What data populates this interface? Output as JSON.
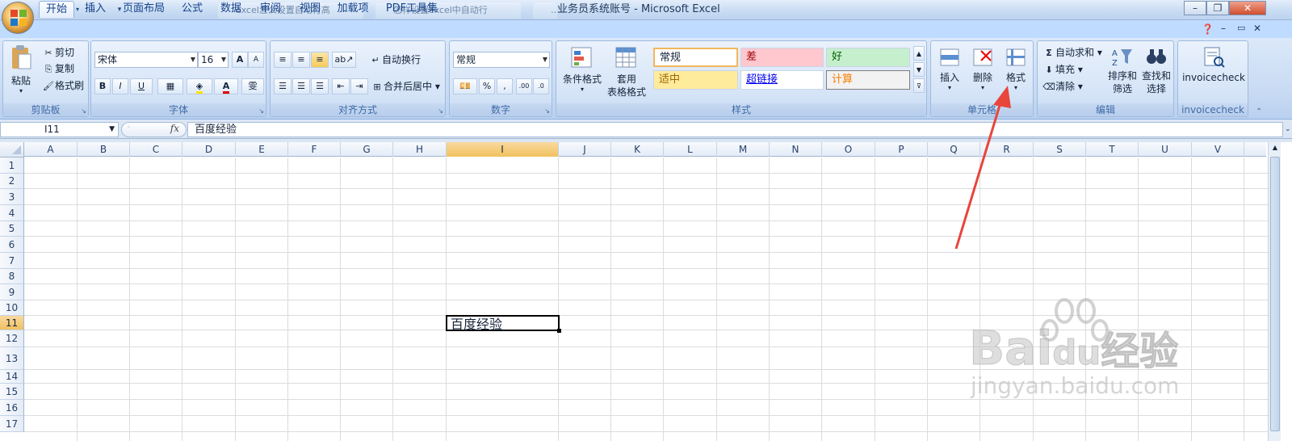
{
  "window": {
    "title": "业务员系统账号 - Microsoft Excel",
    "ghost_tabs": [
      "excel怎么设置自动行高",
      "怎样设置excel中自动行",
      "…"
    ]
  },
  "tabs": [
    "开始",
    "插入",
    "页面布局",
    "公式",
    "数据",
    "审阅",
    "视图",
    "加载项",
    "PDF工具集"
  ],
  "active_tab": "开始",
  "ribbon": {
    "clipboard": {
      "paste": "粘贴",
      "cut": "剪切",
      "copy": "复制",
      "format_painter": "格式刷",
      "label": "剪贴板"
    },
    "font": {
      "font_name": "宋体",
      "font_size": "16",
      "label": "字体",
      "bold": "B",
      "italic": "I",
      "underline": "U",
      "grow": "A",
      "shrink": "A",
      "font_color_letter": "A",
      "phonetic": "雯"
    },
    "alignment": {
      "wrap": "自动换行",
      "merge": "合并后居中",
      "label": "对齐方式"
    },
    "number": {
      "format": "常规",
      "percent": "%",
      "comma": ",",
      "label": "数字"
    },
    "styles": {
      "conditional": "条件格式",
      "table_format_1": "套用",
      "table_format_2": "表格格式",
      "cells": [
        "常规",
        "差",
        "好",
        "适中",
        "超链接",
        "计算"
      ],
      "label": "样式"
    },
    "cells": {
      "insert": "插入",
      "delete": "删除",
      "format": "格式",
      "label": "单元格"
    },
    "editing": {
      "autosum": "自动求和",
      "fill": "填充",
      "clear": "清除",
      "sort_1": "排序和",
      "sort_2": "筛选",
      "find_1": "查找和",
      "find_2": "选择",
      "label": "编辑"
    },
    "invoice": {
      "button": "invoicecheck",
      "label": "invoicecheck"
    }
  },
  "formula_bar": {
    "name_box": "I11",
    "fx": "fx",
    "content": "百度经验"
  },
  "sheet": {
    "columns": [
      "A",
      "B",
      "C",
      "D",
      "E",
      "F",
      "G",
      "H",
      "I",
      "J",
      "K",
      "L",
      "M",
      "N",
      "O",
      "P",
      "Q",
      "R",
      "S",
      "T",
      "U",
      "V"
    ],
    "rows": [
      "1",
      "2",
      "3",
      "4",
      "5",
      "6",
      "7",
      "8",
      "9",
      "10",
      "11",
      "12",
      "13",
      "14",
      "15",
      "16",
      "17"
    ],
    "selected_column": "I",
    "selected_row": "11",
    "active_cell_value": "百度经验"
  },
  "watermark": {
    "brand": "Bai",
    "brand2": "du",
    "cn": "经验",
    "url": "jingyan.baidu.com"
  },
  "colors": {
    "arrow": "#e8453c",
    "selected_header": "#f1c15f",
    "ribbon_bg": "#c7daf3"
  }
}
